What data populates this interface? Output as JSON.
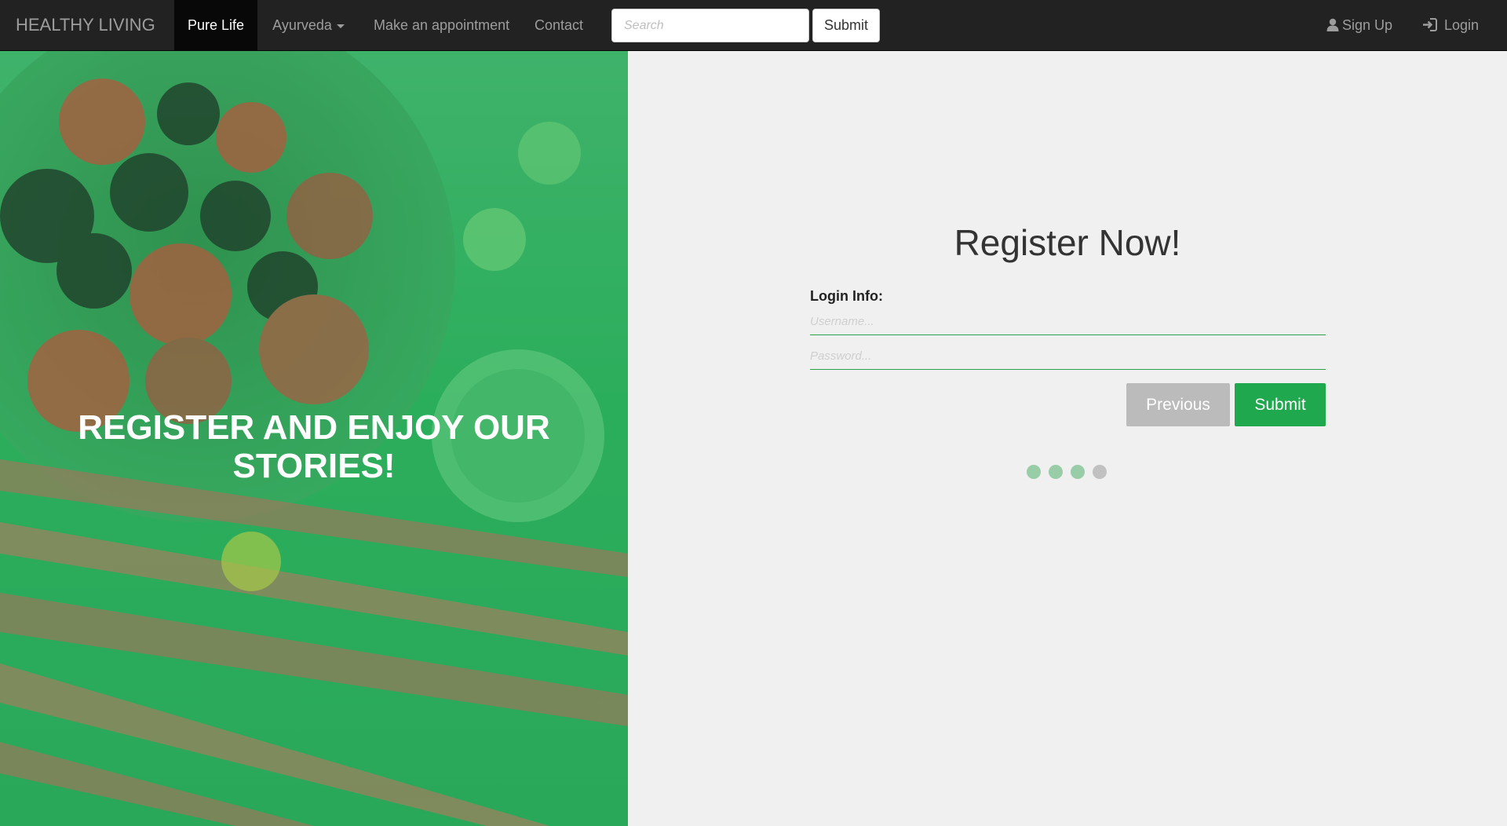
{
  "navbar": {
    "brand": "HEALTHY LIVING",
    "items": [
      {
        "label": "Pure Life",
        "active": true
      },
      {
        "label": "Ayurveda",
        "dropdown": true
      },
      {
        "label": "Make an appointment"
      },
      {
        "label": "Contact"
      }
    ],
    "search": {
      "placeholder": "Search",
      "value": ""
    },
    "search_button": "Submit",
    "signup_label": "Sign Up",
    "login_label": "Login",
    "signup_icon": "user-icon",
    "login_icon": "sign-in-icon"
  },
  "hero": {
    "title": "REGISTER AND ENJOY OUR STORIES!"
  },
  "form": {
    "title": "Register Now!",
    "section_label": "Login Info:",
    "username": {
      "placeholder": "Username...",
      "value": ""
    },
    "password": {
      "placeholder": "Password...",
      "value": ""
    },
    "previous_label": "Previous",
    "submit_label": "Submit",
    "steps": {
      "total": 4,
      "completed": 3
    }
  },
  "colors": {
    "navbar_bg": "#222222",
    "accent_green": "#1fa84d",
    "hero_green": "#2bae5c",
    "page_bg": "#f0f0f0"
  }
}
